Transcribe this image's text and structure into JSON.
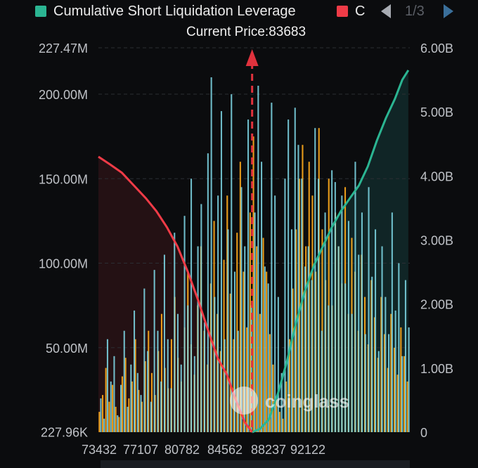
{
  "legend": [
    {
      "label": "Cumulative Short Liquidation Leverage",
      "color": "#2bb592"
    },
    {
      "label": "C",
      "color": "#ef3b47"
    }
  ],
  "pager": {
    "text": "1/3"
  },
  "current_price_label": "Current Price:83683",
  "watermark": "coinglass",
  "chart_data": {
    "type": "bar",
    "title": "",
    "x_ticks": [
      "73432",
      "77107",
      "80782",
      "84562",
      "88237",
      "92122"
    ],
    "x_range": [
      73432,
      94200
    ],
    "current_price": 83683,
    "y_left": {
      "ticks": [
        "227.96K",
        "50.00M",
        "100.00M",
        "150.00M",
        "200.00M",
        "227.47M"
      ],
      "range": [
        227960,
        227470000
      ]
    },
    "y_right": {
      "ticks": [
        "0",
        "1.00B",
        "2.00B",
        "3.00B",
        "4.00B",
        "5.00B",
        "6.00B"
      ],
      "range": [
        0,
        6000000000
      ]
    },
    "grid": true,
    "series": [
      {
        "name": "Cumulative Short Liquidation Leverage",
        "kind": "line",
        "axis": "right",
        "color": "#2bb592",
        "points": [
          [
            83683,
            0
          ],
          [
            84200,
            50000000
          ],
          [
            84800,
            200000000
          ],
          [
            85400,
            600000000
          ],
          [
            86000,
            1100000000
          ],
          [
            86600,
            1700000000
          ],
          [
            87200,
            2200000000
          ],
          [
            87800,
            2600000000
          ],
          [
            88400,
            2900000000
          ],
          [
            89000,
            3200000000
          ],
          [
            89600,
            3450000000
          ],
          [
            90200,
            3650000000
          ],
          [
            90800,
            3850000000
          ],
          [
            91400,
            4150000000
          ],
          [
            92000,
            4550000000
          ],
          [
            92600,
            4900000000
          ],
          [
            93200,
            5200000000
          ],
          [
            93700,
            5500000000
          ],
          [
            94100,
            5650000000
          ]
        ]
      },
      {
        "name": "C",
        "kind": "line",
        "axis": "right",
        "color": "#ef3b47",
        "points": [
          [
            73432,
            4300000000
          ],
          [
            74200,
            4180000000
          ],
          [
            75000,
            4050000000
          ],
          [
            75800,
            3850000000
          ],
          [
            76600,
            3650000000
          ],
          [
            77300,
            3450000000
          ],
          [
            78000,
            3200000000
          ],
          [
            78700,
            2900000000
          ],
          [
            79400,
            2500000000
          ],
          [
            80100,
            2050000000
          ],
          [
            80800,
            1550000000
          ],
          [
            81400,
            1150000000
          ],
          [
            82000,
            900000000
          ],
          [
            82600,
            500000000
          ],
          [
            83200,
            150000000
          ],
          [
            83683,
            0
          ]
        ]
      },
      {
        "name": "",
        "kind": "bars",
        "axis": "left",
        "color": "#f3a21a",
        "values_in_millions": [
          12,
          22,
          38,
          18,
          28,
          15,
          9,
          33,
          44,
          20,
          30,
          55,
          25,
          18,
          42,
          60,
          35,
          22,
          48,
          70,
          38,
          26,
          55,
          80,
          44,
          30,
          62,
          95,
          52,
          34,
          75,
          110,
          60,
          40,
          88,
          125,
          70,
          48,
          102,
          140,
          82,
          55,
          118,
          160,
          95,
          62,
          130,
          175,
          110,
          70,
          115,
          95,
          58,
          40,
          20,
          12,
          8,
          30,
          55,
          85,
          120,
          150,
          170,
          110,
          160,
          140,
          95,
          180,
          120,
          90,
          150,
          75,
          130,
          110,
          88,
          145,
          70,
          115,
          95,
          60,
          105,
          80,
          52,
          90,
          68,
          44,
          80,
          58,
          38,
          70,
          50,
          34,
          62,
          45,
          30
        ]
      },
      {
        "name": "",
        "kind": "bars",
        "axis": "left",
        "color": "#7fd9e8",
        "values_in_millions": [
          20,
          8,
          55,
          30,
          45,
          10,
          28,
          60,
          15,
          40,
          72,
          35,
          22,
          85,
          48,
          18,
          96,
          60,
          30,
          105,
          55,
          26,
          118,
          70,
          40,
          128,
          75,
          150,
          45,
          110,
          135,
          65,
          165,
          210,
          80,
          140,
          190,
          55,
          120,
          200,
          95,
          60,
          145,
          110,
          185,
          75,
          130,
          205,
          160,
          98,
          88,
          195,
          140,
          80,
          35,
          150,
          185,
          120,
          192,
          170,
          150,
          98,
          110,
          90,
          180,
          150,
          60,
          130,
          75,
          155,
          148,
          110,
          140,
          88,
          125,
          70,
          160,
          105,
          130,
          58,
          145,
          92,
          120,
          48,
          110,
          80,
          58,
          130,
          72,
          100,
          45,
          90,
          62
        ]
      }
    ]
  }
}
